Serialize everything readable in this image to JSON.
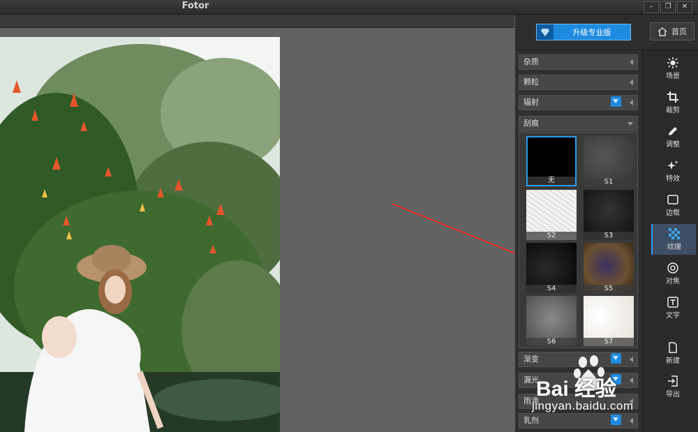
{
  "window": {
    "title": "Fotor",
    "controls": [
      "–",
      "❐",
      "✕"
    ]
  },
  "header": {
    "upgrade_label": "升级专业版",
    "home_label": "首页"
  },
  "panel": {
    "sections_top": [
      {
        "label": "杂质",
        "pro": false
      },
      {
        "label": "颗粒",
        "pro": false
      },
      {
        "label": "辐射",
        "pro": true
      }
    ],
    "open_section": {
      "label": "刮痕"
    },
    "thumbnails": [
      {
        "label": "无",
        "selected": true
      },
      {
        "label": "S1",
        "selected": false
      },
      {
        "label": "S2",
        "selected": false
      },
      {
        "label": "S3",
        "selected": false
      },
      {
        "label": "S4",
        "selected": false
      },
      {
        "label": "S5",
        "selected": false
      },
      {
        "label": "S6",
        "selected": false
      },
      {
        "label": "S7",
        "selected": false
      }
    ],
    "sections_bottom": [
      {
        "label": "渐变",
        "pro": true
      },
      {
        "label": "漏光",
        "pro": true
      },
      {
        "label": "雨滴",
        "pro": false
      },
      {
        "label": "乳剂",
        "pro": true
      }
    ]
  },
  "tools": [
    {
      "label": "场景",
      "icon": "sun-icon"
    },
    {
      "label": "裁剪",
      "icon": "crop-icon"
    },
    {
      "label": "调整",
      "icon": "pencil-icon"
    },
    {
      "label": "特效",
      "icon": "sparkle-icon"
    },
    {
      "label": "边框",
      "icon": "frame-icon"
    },
    {
      "label": "纹理",
      "icon": "texture-icon",
      "active": true
    },
    {
      "label": "对焦",
      "icon": "focus-icon"
    },
    {
      "label": "文字",
      "icon": "text-icon"
    },
    {
      "label": "新建",
      "icon": "new-file-icon"
    },
    {
      "label": "导出",
      "icon": "export-icon"
    }
  ],
  "watermark": {
    "brand": "Bai 经验",
    "url": "jingyan.baidu.com"
  },
  "colors": {
    "accent": "#1e8be0",
    "arrow": "#e8302a"
  }
}
